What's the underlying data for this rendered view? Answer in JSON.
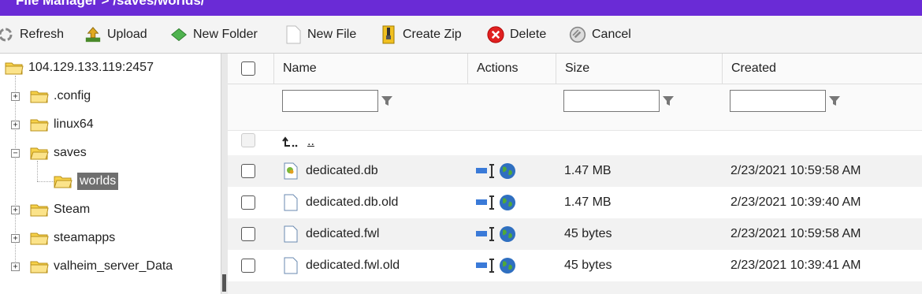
{
  "title": "File Manager > /saves/worlds/",
  "toolbar": {
    "refresh": "Refresh",
    "upload": "Upload",
    "new_folder": "New Folder",
    "new_file": "New File",
    "create_zip": "Create Zip",
    "delete": "Delete",
    "cancel": "Cancel"
  },
  "tree": {
    "root": "104.129.133.119:2457",
    "items": [
      ".config",
      "linux64",
      "saves",
      "worlds",
      "Steam",
      "steamapps",
      "valheim_server_Data"
    ]
  },
  "grid": {
    "columns": {
      "name": "Name",
      "actions": "Actions",
      "size": "Size",
      "created": "Created"
    },
    "parent_link": "..",
    "rows": [
      {
        "name": "dedicated.db",
        "size": "1.47 MB",
        "created": "2/23/2021 10:59:58 AM"
      },
      {
        "name": "dedicated.db.old",
        "size": "1.47 MB",
        "created": "2/23/2021 10:39:40 AM"
      },
      {
        "name": "dedicated.fwl",
        "size": "45 bytes",
        "created": "2/23/2021 10:59:58 AM"
      },
      {
        "name": "dedicated.fwl.old",
        "size": "45 bytes",
        "created": "2/23/2021 10:39:41 AM"
      }
    ]
  }
}
